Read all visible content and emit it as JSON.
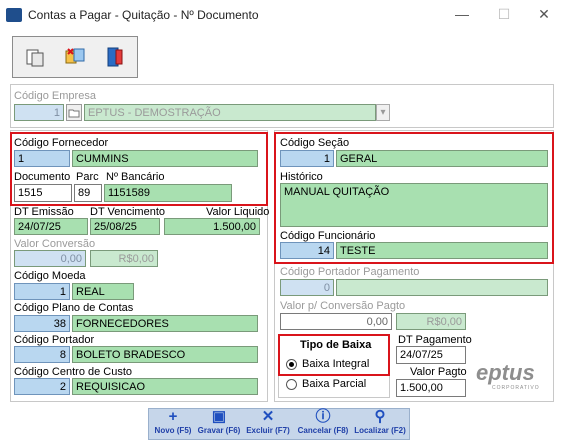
{
  "window": {
    "title": "Contas a Pagar - Quitação - Nº Documento",
    "minimize": "—",
    "maximize": "☐",
    "close": "✕"
  },
  "empresa": {
    "label": "Código Empresa",
    "code": "1",
    "name": "EPTUS - DEMOSTRAÇÃO",
    "dropdown": "▾"
  },
  "fornecedor": {
    "label": "Código Fornecedor",
    "code": "1",
    "name": "CUMMINS"
  },
  "documento": {
    "label": "Documento",
    "value": "1515"
  },
  "parc": {
    "label": "Parc",
    "value": "89"
  },
  "nbancario": {
    "label": "Nº Bancário",
    "value": "1151589"
  },
  "dt_emissao": {
    "label": "DT Emissão",
    "value": "24/07/25"
  },
  "dt_vencimento": {
    "label": "DT Vencimento",
    "value": "25/08/25"
  },
  "valor_liquido": {
    "label": "Valor Liquido",
    "value": "1.500,00"
  },
  "valor_conversao": {
    "label": "Valor Conversão",
    "value1": "0,00",
    "value2": "R$0,00"
  },
  "moeda": {
    "label": "Código Moeda",
    "code": "1",
    "name": "REAL"
  },
  "plano_contas": {
    "label": "Código Plano de Contas",
    "code": "38",
    "name": "FORNECEDORES"
  },
  "portador": {
    "label": "Código Portador",
    "code": "8",
    "name": "BOLETO BRADESCO"
  },
  "centro_custo": {
    "label": "Código Centro de Custo",
    "code": "2",
    "name": "REQUISICAO"
  },
  "secao": {
    "label": "Código Seção",
    "code": "1",
    "name": "GERAL"
  },
  "historico": {
    "label": "Histórico",
    "value": "MANUAL QUITAÇÃO"
  },
  "funcionario": {
    "label": "Código Funcionário",
    "code": "14",
    "name": "TESTE"
  },
  "portador_pagamento": {
    "label": "Código Portador Pagamento",
    "code": "0",
    "name": ""
  },
  "valor_conv_pagto": {
    "label": "Valor p/ Conversão Pagto",
    "value1": "0,00",
    "value2": "R$0,00"
  },
  "tipo_baixa": {
    "title": "Tipo de Baixa",
    "opt_integral": "Baixa Integral",
    "opt_parcial": "Baixa Parcial"
  },
  "dt_pagamento": {
    "label": "DT Pagamento",
    "value": "24/07/25"
  },
  "valor_pagto": {
    "label": "Valor Pagto",
    "value": "1.500,00"
  },
  "logo": {
    "text": "eptus",
    "sub": "CORPORATIVO"
  },
  "actions": {
    "novo": "Novo (F5)",
    "gravar": "Gravar (F6)",
    "excluir": "Excluir (F7)",
    "cancelar": "Cancelar (F8)",
    "localizar": "Localizar (F2)"
  },
  "colors": {
    "field_green": "#a8e0b0",
    "field_blue": "#b9d7f0",
    "highlight_red": "#d9141b",
    "action_blue": "#1f4fbf"
  }
}
